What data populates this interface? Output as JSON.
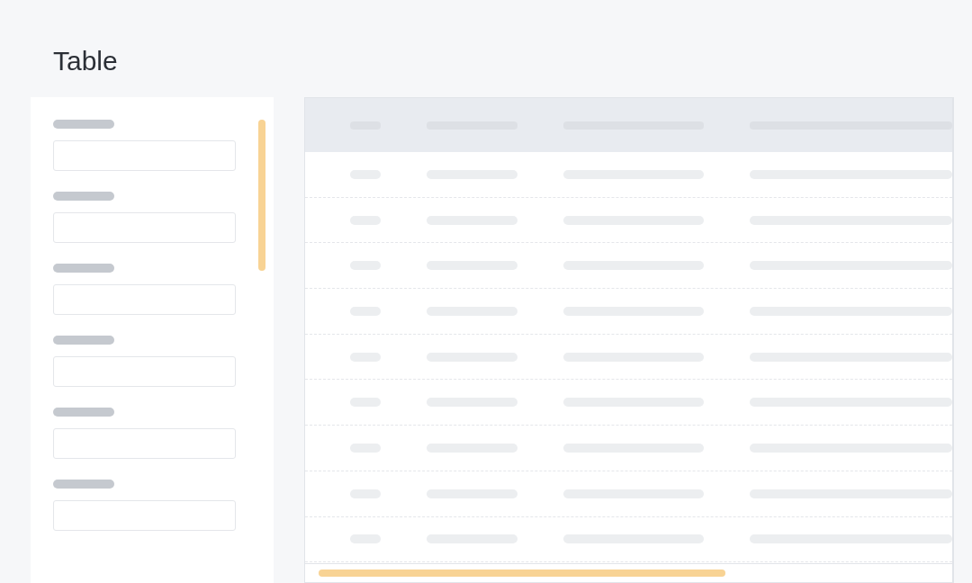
{
  "page": {
    "title": "Table"
  },
  "form": {
    "fields": [
      {
        "kind": "skeleton"
      },
      {
        "kind": "skeleton"
      },
      {
        "kind": "skeleton"
      },
      {
        "kind": "skeleton"
      },
      {
        "kind": "skeleton"
      },
      {
        "kind": "skeleton"
      }
    ]
  },
  "table": {
    "columns": [
      {
        "kind": "skeleton"
      },
      {
        "kind": "skeleton"
      },
      {
        "kind": "skeleton"
      },
      {
        "kind": "skeleton"
      }
    ],
    "rows": [
      {
        "kind": "skeleton"
      },
      {
        "kind": "skeleton"
      },
      {
        "kind": "skeleton"
      },
      {
        "kind": "skeleton"
      },
      {
        "kind": "skeleton"
      },
      {
        "kind": "skeleton"
      },
      {
        "kind": "skeleton"
      },
      {
        "kind": "skeleton"
      },
      {
        "kind": "skeleton"
      }
    ]
  }
}
